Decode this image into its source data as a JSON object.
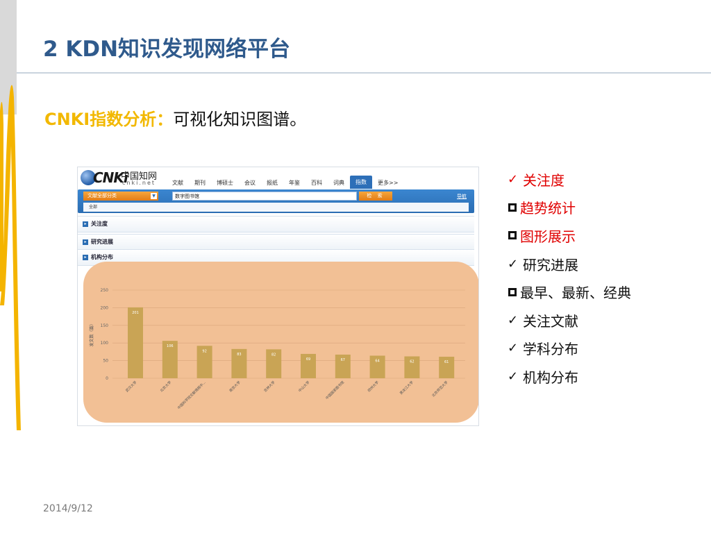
{
  "slide": {
    "title": "2 KDN知识发现网络平台",
    "subtitle_highlight": "CNKI指数分析：",
    "subtitle_rest": "可视化知识图谱。",
    "date": "2014/9/12"
  },
  "screenshot": {
    "logo": {
      "brand": "CNKi",
      "cn": "中国知网",
      "domain": "cnki.net"
    },
    "nav_tabs": [
      {
        "label": "文献",
        "active": false
      },
      {
        "label": "期刊",
        "active": false
      },
      {
        "label": "博硕士",
        "active": false
      },
      {
        "label": "会议",
        "active": false
      },
      {
        "label": "报纸",
        "active": false
      },
      {
        "label": "年鉴",
        "active": false
      },
      {
        "label": "百科",
        "active": false
      },
      {
        "label": "词典",
        "active": false
      },
      {
        "label": "指数",
        "active": true
      },
      {
        "label": "更多>>",
        "active": false
      }
    ],
    "search": {
      "category": "文献全部分类",
      "query": "数字图书馆",
      "button": "检 索",
      "advanced": "导航",
      "scope": "全部"
    },
    "sections": {
      "attention": "关注度",
      "research": "研究进展",
      "institution": "机构分布"
    }
  },
  "chart_data": {
    "type": "bar",
    "ylabel": "发文数（篇）",
    "ylim": [
      0,
      250
    ],
    "yticks": [
      0,
      50,
      100,
      150,
      200,
      250
    ],
    "categories": [
      "武汉大学",
      "北京大学",
      "中国科学院文献情报中…",
      "南京大学",
      "吉林大学",
      "中山大学",
      "中国国家图书馆",
      "郑州大学",
      "黑龙江大学",
      "北京师范大学"
    ],
    "values": [
      201,
      106,
      92,
      83,
      82,
      69,
      67,
      64,
      62,
      61
    ],
    "bar_color": "#c9a455",
    "background": "#f2c095"
  },
  "checklist": [
    {
      "label": "关注度",
      "marker": "check",
      "color": "#e00000"
    },
    {
      "label": "趋势统计",
      "marker": "box",
      "color": "#e00000"
    },
    {
      "label": "图形展示",
      "marker": "box",
      "color": "#e00000"
    },
    {
      "label": "研究进展",
      "marker": "check",
      "color": "#111111"
    },
    {
      "label": "最早、最新、经典",
      "marker": "box",
      "color": "#111111"
    },
    {
      "label": "关注文献",
      "marker": "check",
      "color": "#111111"
    },
    {
      "label": "学科分布",
      "marker": "check",
      "color": "#111111"
    },
    {
      "label": "机构分布",
      "marker": "check",
      "color": "#111111"
    }
  ]
}
